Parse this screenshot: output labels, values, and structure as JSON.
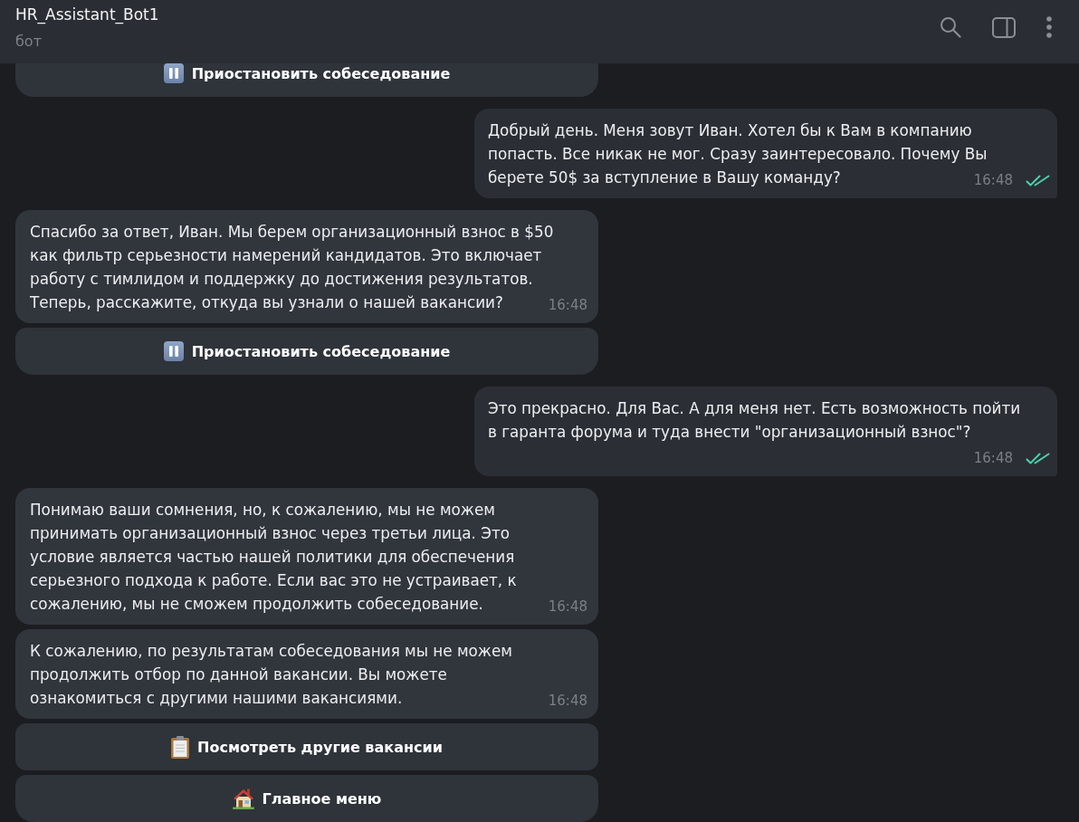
{
  "header": {
    "title": "HR_Assistant_Bot1",
    "subtitle": "бот"
  },
  "messages": [
    {
      "kind": "keyboard",
      "buttons": [
        {
          "kind": "pause",
          "label": "Приостановить собеседование"
        }
      ]
    },
    {
      "kind": "outgoing",
      "text": "Добрый день. Меня зовут Иван. Хотел бы к Вам в компанию\nпопасть. Все никак не мог. Сразу заинтересовало. Почему Вы\nберете 50$ за вступление в Вашу команду?",
      "time": "16:48",
      "read": true
    },
    {
      "kind": "incoming",
      "text": "Спасибо за ответ, Иван. Мы берем организационный взнос в $50\nкак фильтр серьезности намерений кандидатов. Это включает\nработу с тимлидом и поддержку до достижения результатов.\nТеперь, расскажите, откуда вы узнали о нашей вакансии?",
      "time": "16:48",
      "buttons": [
        {
          "kind": "pause",
          "label": "Приостановить собеседование"
        }
      ]
    },
    {
      "kind": "outgoing",
      "text": "Это прекрасно. Для Вас. А для меня нет. Есть возможность пойти\nв гаранта форума и туда внести \"организационный взнос\"?",
      "time": "16:48",
      "read": true
    },
    {
      "kind": "incoming",
      "text": "Понимаю ваши сомнения, но, к сожалению, мы не можем\nпринимать организационный взнос через третьи лица. Это\nусловие является частью нашей политики для обеспечения\nсерьезного подхода к работе. Если вас это не устраивает, к\nсожалению, мы не сможем продолжить собеседование.",
      "time": "16:48"
    },
    {
      "kind": "incoming",
      "text": "К сожалению, по результатам собеседования мы не можем\nпродолжить отбор по данной вакансии. Вы можете\nознакомиться с другими нашими вакансиями.",
      "time": "16:48",
      "buttons": [
        {
          "kind": "clipboard",
          "label": "Посмотреть другие вакансии"
        },
        {
          "kind": "house",
          "label": "Главное меню"
        }
      ]
    }
  ]
}
